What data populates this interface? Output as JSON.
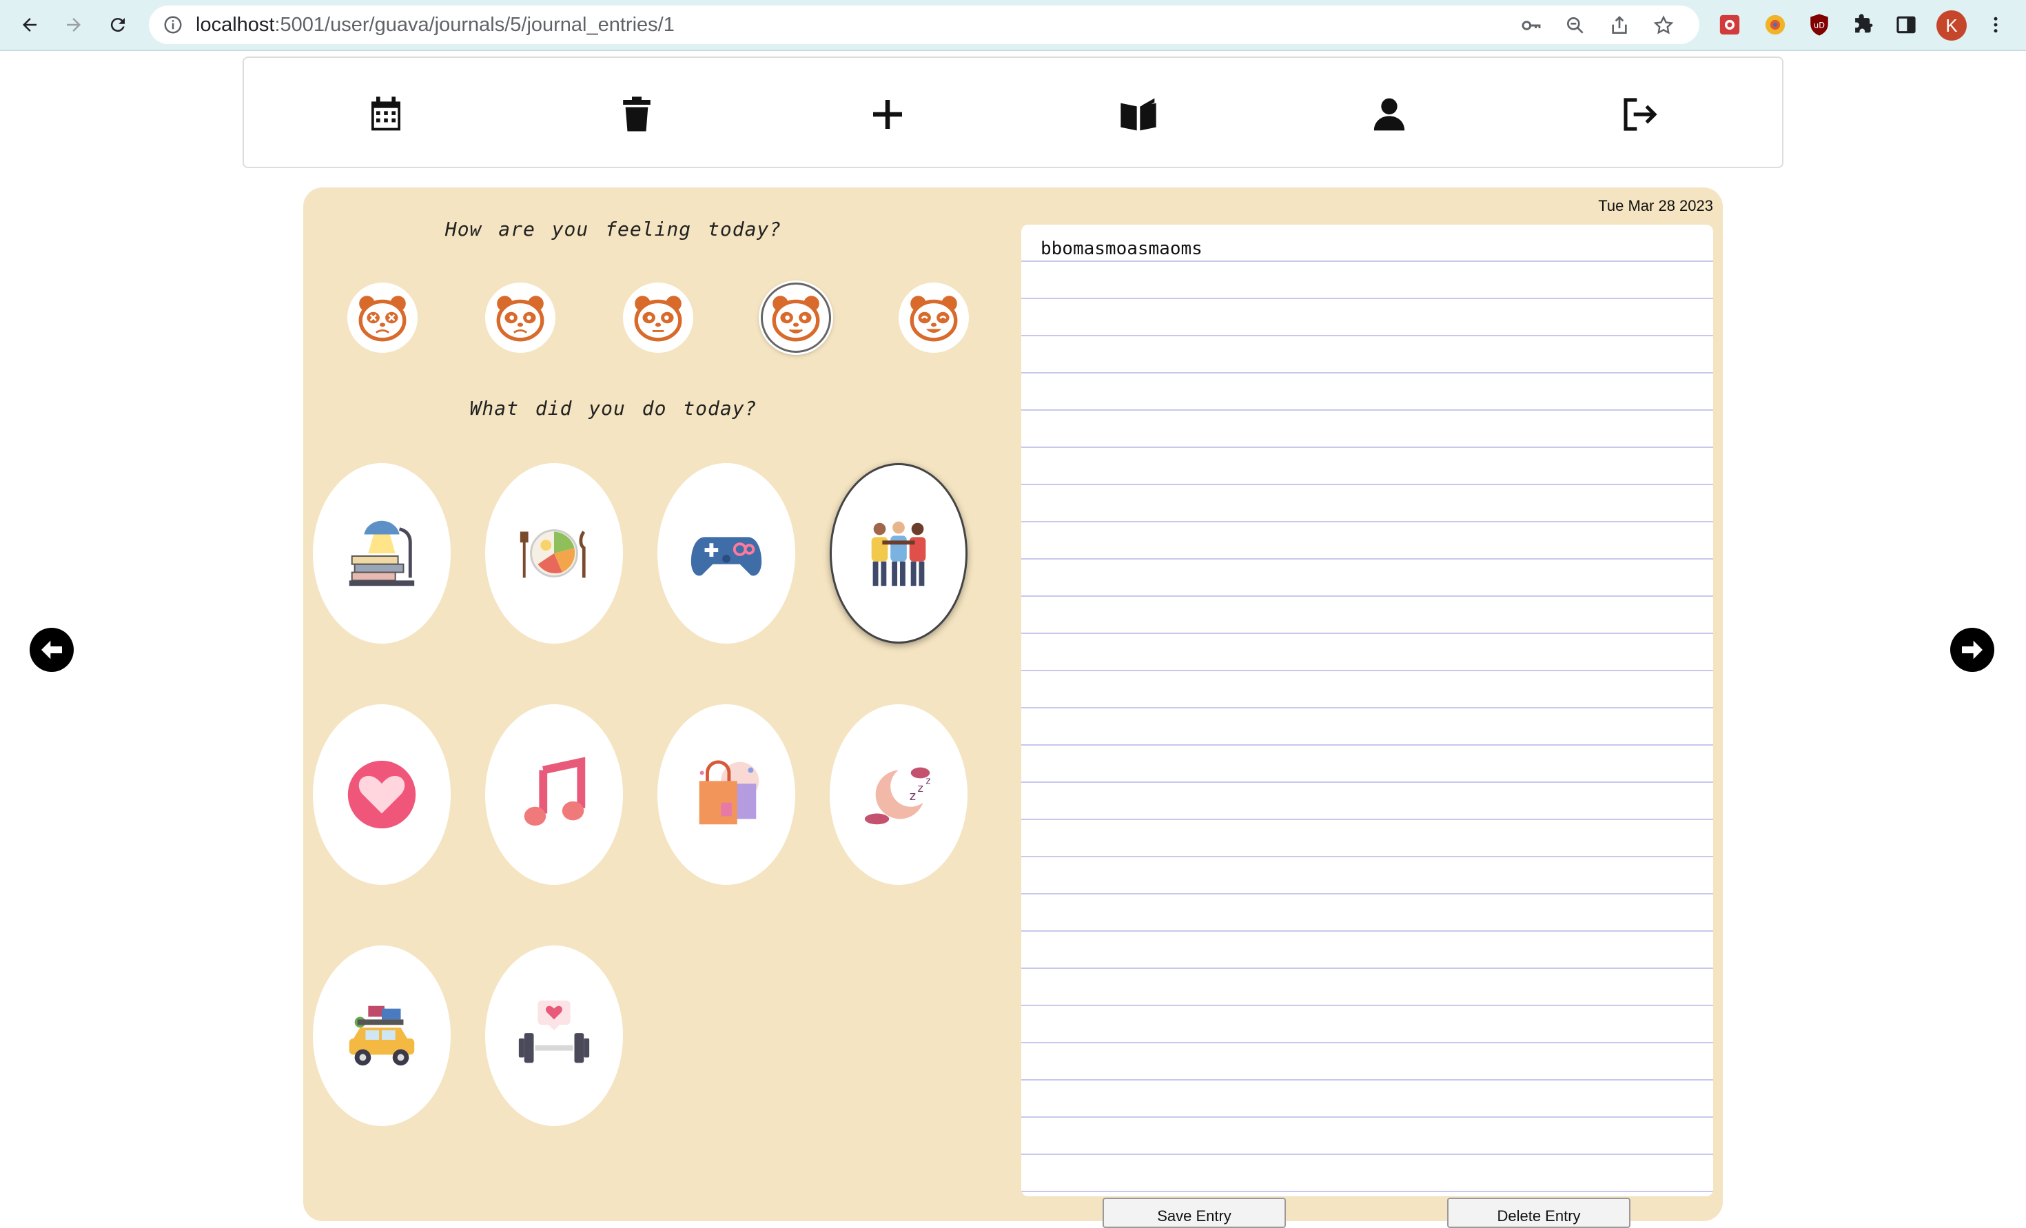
{
  "browser": {
    "url_host": "localhost",
    "url_path": ":5001/user/guava/journals/5/journal_entries/1",
    "profile_initial": "K"
  },
  "toolbar": {
    "items": [
      "calendar-icon",
      "trash-icon",
      "plus-icon",
      "book-open-icon",
      "user-icon",
      "logout-icon"
    ]
  },
  "journal": {
    "date": "Tue Mar 28 2023",
    "feeling_question": "How are you feeling today?",
    "activity_question": "What did you do today?",
    "moods": [
      {
        "icon": "panda-dizzy-icon",
        "selected": false
      },
      {
        "icon": "panda-sad-icon",
        "selected": false
      },
      {
        "icon": "panda-neutral-icon",
        "selected": false
      },
      {
        "icon": "panda-happy-icon",
        "selected": true
      },
      {
        "icon": "panda-joyful-icon",
        "selected": false
      }
    ],
    "activities": [
      {
        "icon": "study-books-lamp-icon",
        "selected": false
      },
      {
        "icon": "meal-plate-icon",
        "selected": false
      },
      {
        "icon": "game-controller-icon",
        "selected": false
      },
      {
        "icon": "friends-group-icon",
        "selected": true
      },
      {
        "icon": "heart-icon",
        "selected": false
      },
      {
        "icon": "music-note-icon",
        "selected": false
      },
      {
        "icon": "shopping-bag-icon",
        "selected": false
      },
      {
        "icon": "sleep-moon-icon",
        "selected": false
      },
      {
        "icon": "travel-car-icon",
        "selected": false
      },
      {
        "icon": "exercise-dumbbell-icon",
        "selected": false
      }
    ],
    "entry_text": "bbomasmoasmaoms",
    "save_label": "Save Entry",
    "delete_label": "Delete Entry"
  },
  "colors": {
    "card_bg": "#f4e4c1",
    "chrome_bg": "#dff1f3",
    "paper_line": "#c7c8ec",
    "panda_orange": "#d86a2c"
  }
}
